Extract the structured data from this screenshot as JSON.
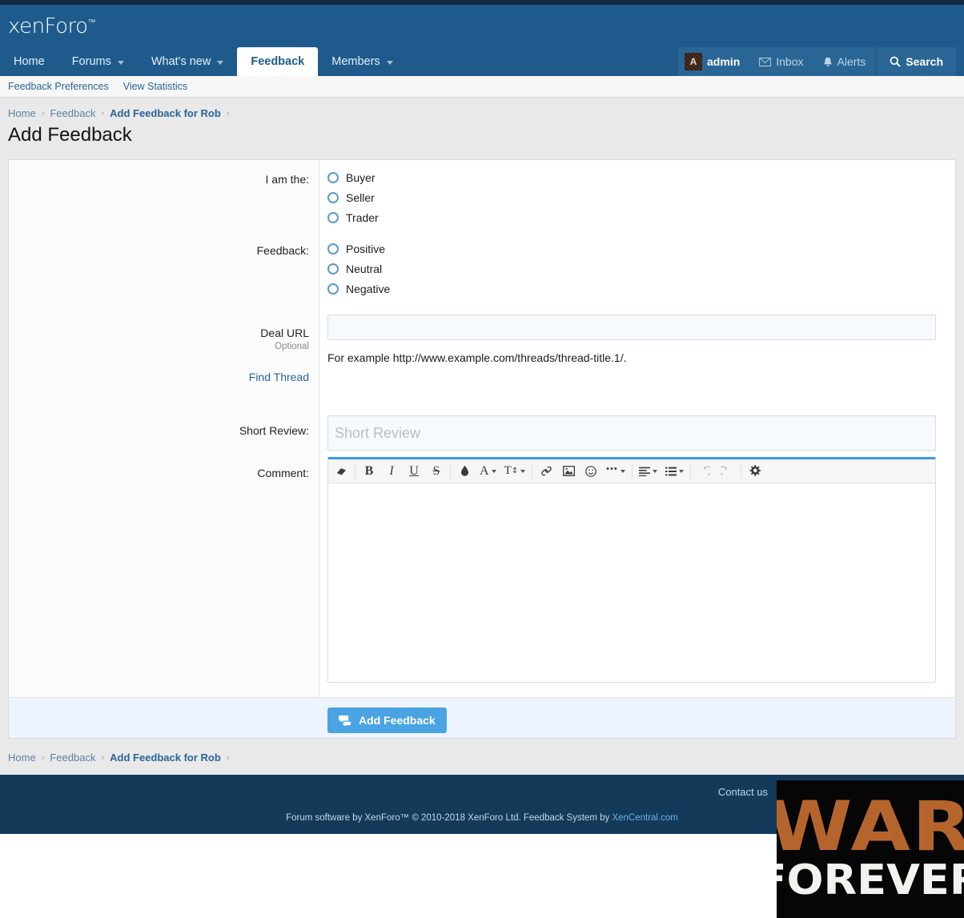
{
  "site": {
    "logo_text": "xenForo",
    "logo_tm": "™"
  },
  "nav": {
    "items": [
      {
        "label": "Home",
        "has_caret": false,
        "active": false
      },
      {
        "label": "Forums",
        "has_caret": true,
        "active": false
      },
      {
        "label": "What's new",
        "has_caret": true,
        "active": false
      },
      {
        "label": "Feedback",
        "has_caret": false,
        "active": true
      },
      {
        "label": "Members",
        "has_caret": true,
        "active": false
      }
    ]
  },
  "userbar": {
    "avatar_letter": "A",
    "visitor": "admin",
    "inbox": "Inbox",
    "alerts": "Alerts",
    "search": "Search",
    "icons": {
      "inbox": "envelope-icon",
      "alerts": "bell-icon",
      "search": "search-icon"
    }
  },
  "subnav": {
    "items": [
      {
        "label": "Feedback Preferences"
      },
      {
        "label": "View Statistics"
      }
    ]
  },
  "breadcrumb": {
    "items": [
      {
        "label": "Home",
        "current": false
      },
      {
        "label": "Feedback",
        "current": false
      },
      {
        "label": "Add Feedback for Rob",
        "current": true
      }
    ],
    "separator": "›"
  },
  "page": {
    "title": "Add Feedback"
  },
  "form": {
    "i_am_the": {
      "label": "I am the:",
      "options": [
        {
          "label": "Buyer",
          "selected": false
        },
        {
          "label": "Seller",
          "selected": false
        },
        {
          "label": "Trader",
          "selected": false
        }
      ]
    },
    "feedback": {
      "label": "Feedback:",
      "options": [
        {
          "label": "Positive",
          "selected": false
        },
        {
          "label": "Neutral",
          "selected": false
        },
        {
          "label": "Negative",
          "selected": false
        }
      ]
    },
    "deal_url": {
      "label": "Deal URL",
      "hint": "Optional",
      "value": "",
      "placeholder": "",
      "explain": "For example http://www.example.com/threads/thread-title.1/."
    },
    "find_thread": {
      "label": "Find Thread"
    },
    "short_review": {
      "label": "Short Review:",
      "value": "",
      "placeholder": "Short Review"
    },
    "comment": {
      "label": "Comment:",
      "value": "",
      "toolbar": [
        {
          "name": "remove-formatting-icon",
          "glyph": "▱",
          "caret": false,
          "disabled": false
        },
        {
          "name": "separator",
          "glyph": "",
          "caret": false,
          "disabled": false
        },
        {
          "name": "bold-icon",
          "glyph": "B",
          "caret": false,
          "disabled": false
        },
        {
          "name": "italic-icon",
          "glyph": "I",
          "caret": false,
          "disabled": false
        },
        {
          "name": "underline-icon",
          "glyph": "U",
          "caret": false,
          "disabled": false
        },
        {
          "name": "strikethrough-icon",
          "glyph": "S",
          "caret": false,
          "disabled": false
        },
        {
          "name": "separator",
          "glyph": "",
          "caret": false,
          "disabled": false
        },
        {
          "name": "text-color-icon",
          "glyph": "◆",
          "caret": false,
          "disabled": false
        },
        {
          "name": "font-family-icon",
          "glyph": "A",
          "caret": true,
          "disabled": false
        },
        {
          "name": "font-size-icon",
          "glyph": "T↕",
          "caret": true,
          "disabled": false
        },
        {
          "name": "separator",
          "glyph": "",
          "caret": false,
          "disabled": false
        },
        {
          "name": "link-icon",
          "glyph": "⚭",
          "caret": false,
          "disabled": false
        },
        {
          "name": "image-icon",
          "glyph": "▣",
          "caret": false,
          "disabled": false
        },
        {
          "name": "smilie-icon",
          "glyph": "☺",
          "caret": false,
          "disabled": false
        },
        {
          "name": "more-options-icon",
          "glyph": "•••",
          "caret": true,
          "disabled": false
        },
        {
          "name": "separator",
          "glyph": "",
          "caret": false,
          "disabled": false
        },
        {
          "name": "align-icon",
          "glyph": "≡",
          "caret": true,
          "disabled": false
        },
        {
          "name": "list-icon",
          "glyph": "☰",
          "caret": true,
          "disabled": false
        },
        {
          "name": "separator",
          "glyph": "",
          "caret": false,
          "disabled": false
        },
        {
          "name": "undo-icon",
          "glyph": "↺",
          "caret": false,
          "disabled": true
        },
        {
          "name": "redo-icon",
          "glyph": "↻",
          "caret": false,
          "disabled": true
        },
        {
          "name": "separator",
          "glyph": "",
          "caret": false,
          "disabled": false
        },
        {
          "name": "editor-settings-gear-icon",
          "glyph": "⚙",
          "caret": false,
          "disabled": false
        }
      ]
    }
  },
  "submit": {
    "label": "Add Feedback",
    "icon": "comments-icon"
  },
  "footer": {
    "contact_us": "Contact us",
    "legal_prefix": "Forum software by XenForo™ © 2010-2018 XenForo Ltd. Feedback System by ",
    "legal_link": "XenCentral.com"
  },
  "banner": {
    "line1": "WAR",
    "line2": "FOREVER"
  },
  "colors": {
    "header_blue": "#1e5b8c",
    "top_strip": "#0f2b42",
    "accent_blue": "#4aa3e3",
    "link_blue": "#2a6496",
    "footer_blue": "#143a5a",
    "banner_orange": "#b5652c"
  }
}
